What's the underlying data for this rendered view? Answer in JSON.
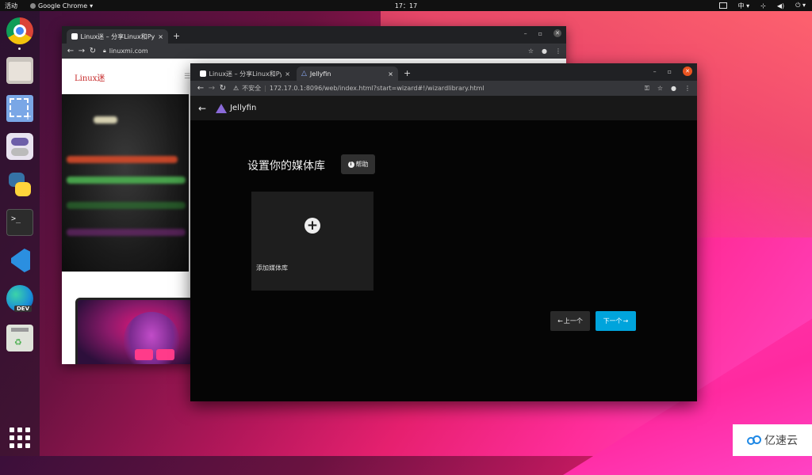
{
  "topbar": {
    "activities": "活动",
    "app_name": "Google Chrome",
    "clock": "17：17",
    "input_method": "中",
    "colors": {
      "background": "#111111"
    }
  },
  "dock": {
    "items": [
      "chrome-icon",
      "files-icon",
      "screenshot-icon",
      "settings-icon",
      "python-icon",
      "terminal-icon",
      "vscode-icon",
      "edge-dev-icon",
      "trash-icon",
      "app-grid-icon"
    ],
    "terminal_glyph": ">_",
    "edge_badge": "DEV"
  },
  "back_window": {
    "tabs": [
      {
        "label": "Linux迷 – 分享Linux和Pyt"
      }
    ],
    "new_tab": "+",
    "url": "linuxmi.com",
    "site_logo": "Linux迷"
  },
  "front_window": {
    "tabs": [
      {
        "label": "Linux迷 – 分享Linux和Pyt"
      },
      {
        "label": "Jellyfin"
      }
    ],
    "new_tab": "+",
    "security_label": "不安全",
    "url": "172.17.0.1:8096/web/index.html?start=wizard#!/wizardlibrary.html",
    "brand": "Jellyfin",
    "page_title": "设置你的媒体库",
    "help_label": "帮助",
    "add_library_label": "添加媒体库",
    "prev_label": "上一个",
    "next_label": "下一个",
    "colors": {
      "accent": "#00a4dc",
      "brand_gradient_start": "#aa5cc3",
      "brand_gradient_end": "#00a4dc"
    }
  },
  "watermark": {
    "text": "亿速云"
  }
}
